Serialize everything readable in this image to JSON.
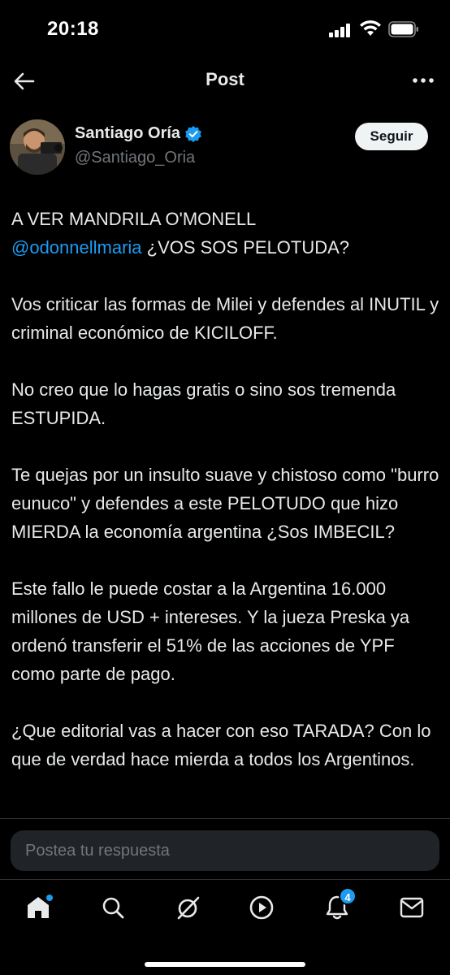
{
  "status_bar": {
    "time": "20:18"
  },
  "header": {
    "title": "Post"
  },
  "author": {
    "name": "Santiago Oría",
    "handle": "@Santiago_Oria",
    "follow_label": "Seguir"
  },
  "post": {
    "line1": "A VER MANDRILA O'MONELL",
    "mention": "@odonnellmaria",
    "line1_rest": " ¿VOS SOS PELOTUDA?",
    "p2": "Vos criticar las formas de Milei y defendes al INUTIL y criminal económico de KICILOFF.",
    "p3": "No creo que lo hagas gratis o sino sos tremenda ESTUPIDA.",
    "p4": "Te quejas por un insulto suave y chistoso como \"burro eunuco\" y defendes a este PELOTUDO que hizo MIERDA la economía argentina ¿Sos IMBECIL?",
    "p5": "Este fallo le puede costar a la Argentina 16.000 millones de USD + intereses. Y la jueza Preska ya ordenó transferir el 51% de las acciones de YPF como parte de pago.",
    "p6": "¿Que editorial vas a hacer con eso TARADA? Con lo que de verdad hace mierda a todos los Argentinos."
  },
  "reply": {
    "placeholder": "Postea tu respuesta"
  },
  "nav": {
    "notifications_badge": "4",
    "icons": [
      "home-icon",
      "search-icon",
      "grok-icon",
      "video-icon",
      "notifications-icon",
      "messages-icon"
    ]
  },
  "colors": {
    "accent": "#1d9bf0",
    "background": "#000000",
    "muted": "#71767b"
  }
}
